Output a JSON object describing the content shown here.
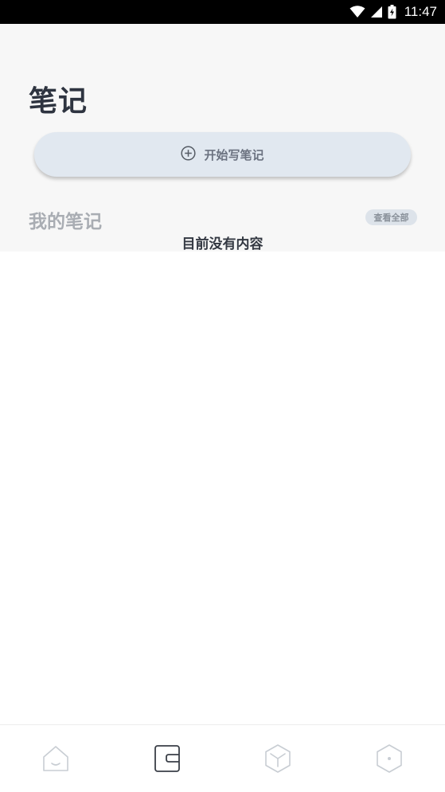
{
  "status_bar": {
    "time": "11:47",
    "icons": [
      "wifi-icon",
      "cell-signal-icon",
      "battery-charging-icon"
    ]
  },
  "header": {
    "title": "笔记"
  },
  "new_note": {
    "icon": "plus-circle-icon",
    "label": "开始写笔记"
  },
  "my_notes": {
    "title": "我的笔记",
    "view_all_label": "查看全部",
    "empty_text": "目前没有内容"
  },
  "bottom_nav": {
    "items": [
      {
        "name": "home",
        "icon": "home-icon",
        "active": false
      },
      {
        "name": "notes",
        "icon": "notebook-icon",
        "active": true
      },
      {
        "name": "cube",
        "icon": "cube-icon",
        "active": false
      },
      {
        "name": "profile",
        "icon": "hexagon-dot-icon",
        "active": false
      }
    ]
  },
  "colors": {
    "status_bar_bg": "#000000",
    "top_area_bg": "#f7f7f7",
    "button_bg": "#e1e8f0",
    "title_text": "#2e3440",
    "muted_text": "#a9adb3",
    "nav_active": "#3a3f47",
    "nav_inactive": "#c8cdd3"
  }
}
